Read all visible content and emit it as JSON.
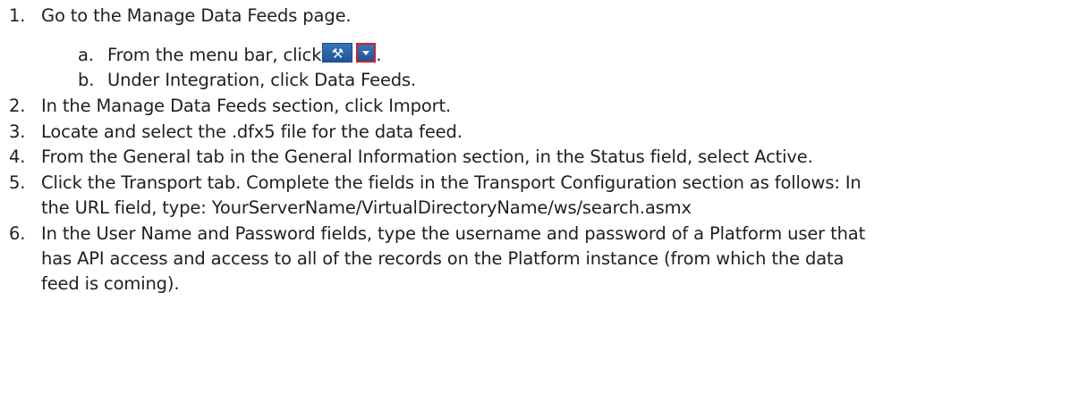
{
  "steps": [
    {
      "num": "1.",
      "text": "Go to the Manage Data Feeds page."
    },
    {
      "num": "2.",
      "text": "In the Manage Data Feeds section, click Import."
    },
    {
      "num": "3.",
      "text": "Locate and select the .dfx5 file for the data feed."
    },
    {
      "num": "4.",
      "text": "From the General tab in the General Information section, in the Status field, select Active."
    },
    {
      "num": "5.",
      "line1": "Click the Transport tab. Complete the fields in the Transport Configuration section as follows: In",
      "line2": "the URL field, type: YourServerName/VirtualDirectoryName/ws/search.asmx"
    },
    {
      "num": "6.",
      "line1": "In the User Name and Password fields, type the username and password of a Platform user that",
      "line2": "has API access and access to all of the records on the Platform instance (from which the data",
      "line3": "feed is coming)."
    }
  ],
  "substeps": [
    {
      "num": "a.",
      "text": "From the menu bar, click",
      "after": "."
    },
    {
      "num": "b.",
      "text": "Under Integration, click Data Feeds."
    }
  ],
  "icons": {
    "tools": "tools-icon",
    "dropdown": "chevron-down-icon",
    "tools_glyph": "⚒"
  },
  "colors": {
    "button_blue": "#2a63a8",
    "highlight_red": "#d0202a"
  }
}
